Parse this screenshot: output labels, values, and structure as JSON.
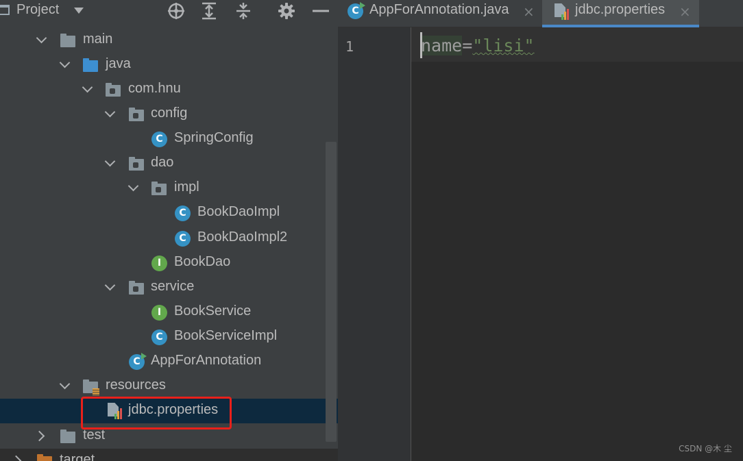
{
  "project_panel": {
    "title": "Project",
    "toolbar": {
      "locate_icon": "crosshair-icon",
      "expand_icon": "expand-all-icon",
      "collapse_icon": "collapse-all-icon",
      "settings_icon": "gear-icon",
      "hide_icon": "minimize-icon"
    },
    "tree": [
      {
        "label": "main",
        "kind": "folder"
      },
      {
        "label": "java",
        "kind": "source-folder"
      },
      {
        "label": "com.hnu",
        "kind": "package"
      },
      {
        "label": "config",
        "kind": "package"
      },
      {
        "label": "SpringConfig",
        "kind": "class"
      },
      {
        "label": "dao",
        "kind": "package"
      },
      {
        "label": "impl",
        "kind": "package"
      },
      {
        "label": "BookDaoImpl",
        "kind": "class"
      },
      {
        "label": "BookDaoImpl2",
        "kind": "class"
      },
      {
        "label": "BookDao",
        "kind": "interface"
      },
      {
        "label": "service",
        "kind": "package"
      },
      {
        "label": "BookService",
        "kind": "interface"
      },
      {
        "label": "BookServiceImpl",
        "kind": "class"
      },
      {
        "label": "AppForAnnotation",
        "kind": "runnable-class"
      },
      {
        "label": "resources",
        "kind": "resources-folder"
      },
      {
        "label": "jdbc.properties",
        "kind": "properties-file",
        "selected": true
      },
      {
        "label": "test",
        "kind": "folder"
      },
      {
        "label": "target",
        "kind": "excluded-folder"
      }
    ]
  },
  "editor": {
    "tabs": [
      {
        "label": "AppForAnnotation.java",
        "active": false,
        "close": "×"
      },
      {
        "label": "jdbc.properties",
        "active": true,
        "close": "×"
      }
    ],
    "lines": [
      {
        "number": "1",
        "key": "name",
        "eq": "=",
        "value": "\"lisi\""
      }
    ]
  },
  "watermark": "CSDN @木 尘",
  "colors": {
    "highlight_box": "#e8201a",
    "selection": "#0d293e",
    "active_tab_underline": "#4a88c7"
  }
}
